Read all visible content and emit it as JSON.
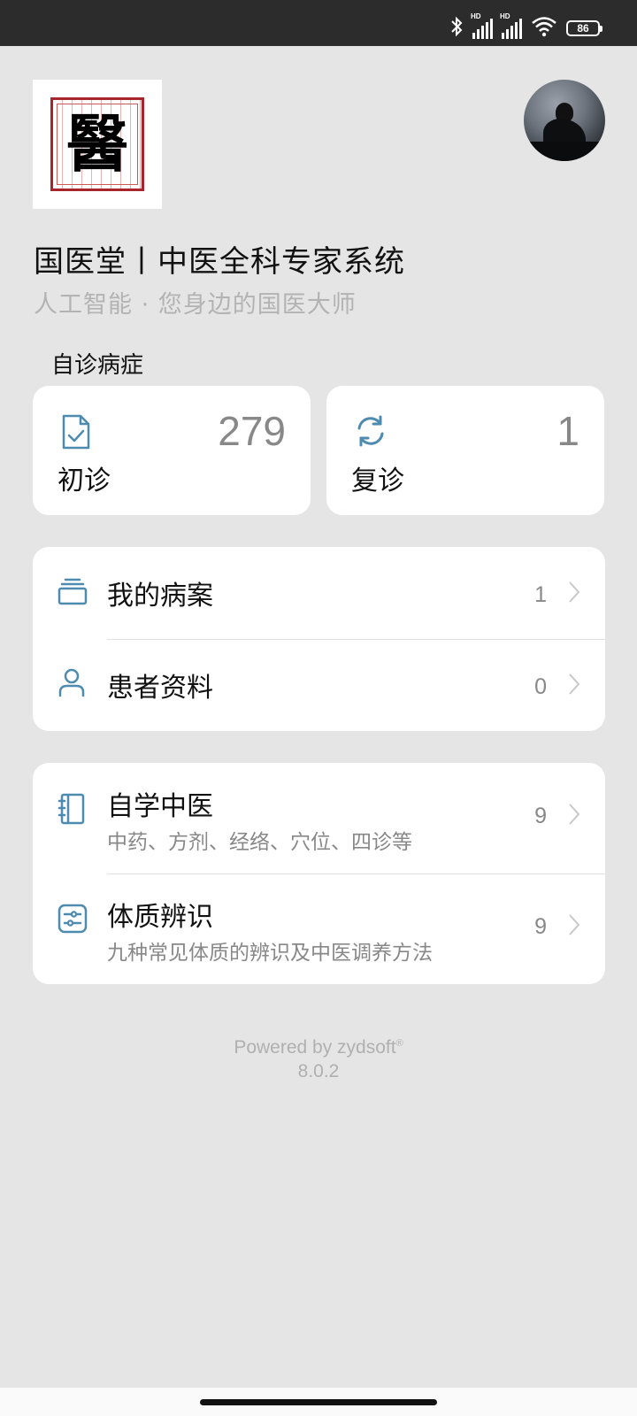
{
  "status": {
    "battery": "86",
    "signal1": "HD",
    "signal2": "HD"
  },
  "header": {
    "logo_text": "醫",
    "title": "国医堂丨中医全科专家系统",
    "subtitle": "人工智能 · 您身边的国医大师"
  },
  "self_diagnosis": {
    "label": "自诊病症",
    "cards": [
      {
        "label": "初诊",
        "count": "279",
        "icon": "document-check-icon"
      },
      {
        "label": "复诊",
        "count": "1",
        "icon": "refresh-icon"
      }
    ]
  },
  "records": [
    {
      "label": "我的病案",
      "count": "1",
      "icon": "folder-stack-icon"
    },
    {
      "label": "患者资料",
      "count": "0",
      "icon": "person-icon"
    }
  ],
  "learning": [
    {
      "label": "自学中医",
      "desc": "中药、方剂、经络、穴位、四诊等",
      "count": "9",
      "icon": "notebook-icon"
    },
    {
      "label": "体质辨识",
      "desc": "九种常见体质的辨识及中医调养方法",
      "count": "9",
      "icon": "sliders-icon"
    }
  ],
  "footer": {
    "powered_by": "Powered by zydsoft",
    "trademark": "®",
    "version": "8.0.2"
  },
  "colors": {
    "accent": "#4e8bb0",
    "background": "#e5e5e5",
    "logo_red": "#a8262b"
  }
}
